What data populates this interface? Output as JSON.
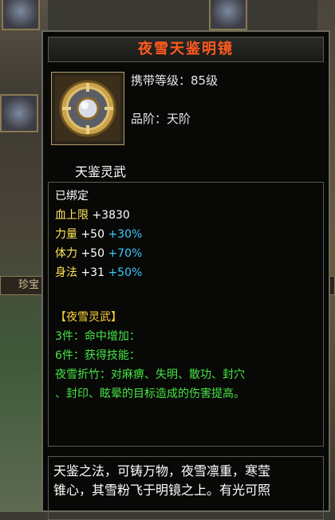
{
  "item": {
    "name": "夜雪天鉴明镜",
    "requirement": "携带等级：85级",
    "grade": "品阶：天阶",
    "set_title": "天鉴灵武"
  },
  "stats": {
    "bound": "已绑定",
    "hp_label": "血上限",
    "hp_value": "+3830",
    "str_label": "力量",
    "str_value": "+50",
    "str_bonus": "+30%",
    "con_label": "体力",
    "con_value": "+50",
    "con_bonus": "+70%",
    "agi_label": "身法",
    "agi_value": "+31",
    "agi_bonus": "+50%"
  },
  "set": {
    "header": "【夜雪灵武】",
    "piece3": "3件：命中增加：",
    "piece6": "6件：获得技能：",
    "skill_line1": "夜雪折竹：对麻痹、失明、散功、封穴",
    "skill_line2": "、封印、眩晕的目标造成的伤害提高。"
  },
  "description": {
    "line1": "天鉴之法，可铸万物，夜雪凛重，寒莹",
    "line2": "锥心，其雪粉飞于明镜之上。有光可照"
  },
  "background": {
    "tab_label": "珍宝"
  },
  "colors": {
    "title": "#ff5a1e",
    "stat_yellow": "#ffe65a",
    "bonus_cyan": "#3cc8ff",
    "set_green": "#46e646",
    "set_header": "#ffd23c"
  }
}
